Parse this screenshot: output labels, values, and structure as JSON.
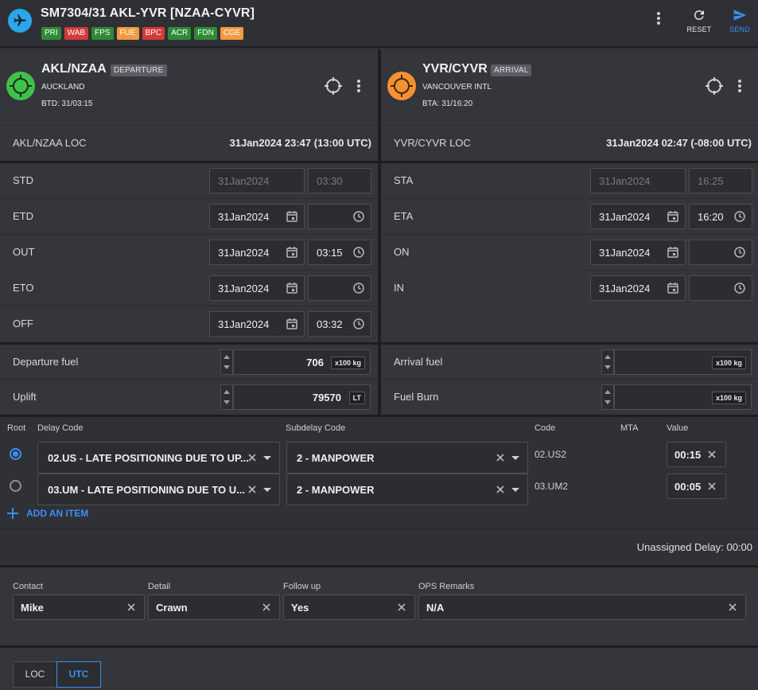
{
  "header": {
    "title": "SM7304/31 AKL-YVR [NZAA-CYVR]",
    "badges": [
      {
        "label": "PRI",
        "color": "#2f8a35"
      },
      {
        "label": "WAB",
        "color": "#d33a3a"
      },
      {
        "label": "FPS",
        "color": "#2f8a35"
      },
      {
        "label": "FUE",
        "color": "#f29a3f"
      },
      {
        "label": "BPC",
        "color": "#d33a3a"
      },
      {
        "label": "ACR",
        "color": "#2f8a35"
      },
      {
        "label": "FDN",
        "color": "#2f8a35"
      },
      {
        "label": "CGE",
        "color": "#f29a3f"
      }
    ],
    "reset_label": "RESET",
    "send_label": "SEND",
    "accent_color": "#3b8ef3"
  },
  "departure": {
    "code": "AKL/NZAA",
    "tag": "DEPARTURE",
    "city": "AUCKLAND",
    "btd": "BTD: 31/03:15",
    "status_color": "#3fc24a",
    "loc_label": "AKL/NZAA LOC",
    "loc_value": "31Jan2024 23:47 (13:00 UTC)",
    "times": [
      {
        "label": "STD",
        "date": "31Jan2024",
        "time": "03:30",
        "disabled": true
      },
      {
        "label": "ETD",
        "date": "31Jan2024",
        "time": ""
      },
      {
        "label": "OUT",
        "date": "31Jan2024",
        "time": "03:15"
      },
      {
        "label": "ETO",
        "date": "31Jan2024",
        "time": ""
      },
      {
        "label": "OFF",
        "date": "31Jan2024",
        "time": "03:32"
      }
    ],
    "fuel": [
      {
        "label": "Departure fuel",
        "value": "706",
        "unit": "x100 kg"
      },
      {
        "label": "Uplift",
        "value": "79570",
        "unit": "LT"
      }
    ]
  },
  "arrival": {
    "code": "YVR/CYVR",
    "tag": "ARRIVAL",
    "city": "VANCOUVER INTL",
    "bta": "BTA: 31/16:20",
    "status_color": "#f5922f",
    "loc_label": "YVR/CYVR LOC",
    "loc_value": "31Jan2024 02:47 (-08:00 UTC)",
    "times": [
      {
        "label": "STA",
        "date": "31Jan2024",
        "time": "16:25",
        "disabled": true
      },
      {
        "label": "ETA",
        "date": "31Jan2024",
        "time": "16:20"
      },
      {
        "label": "ON",
        "date": "31Jan2024",
        "time": ""
      },
      {
        "label": "IN",
        "date": "31Jan2024",
        "time": ""
      }
    ],
    "fuel": [
      {
        "label": "Arrival fuel",
        "value": "",
        "unit": "x100 kg"
      },
      {
        "label": "Fuel Burn",
        "value": "",
        "unit": "x100 kg"
      }
    ]
  },
  "delays": {
    "headers": {
      "root": "Root",
      "delay_code": "Delay Code",
      "subdelay_code": "Subdelay Code",
      "code": "Code",
      "mta": "MTA",
      "value": "Value"
    },
    "rows": [
      {
        "root": true,
        "delay": "02.US - LATE POSITIONING DUE TO UP...",
        "subdelay": "2 - MANPOWER",
        "code": "02.US2",
        "value": "00:15"
      },
      {
        "root": false,
        "delay": "03.UM - LATE POSITIONING DUE TO U...",
        "subdelay": "2 - MANPOWER",
        "code": "03.UM2",
        "value": "00:05"
      }
    ],
    "add_label": "ADD AN ITEM",
    "unassigned": "Unassigned Delay: 00:00"
  },
  "contact": {
    "contact_label": "Contact",
    "contact_value": "Mike",
    "detail_label": "Detail",
    "detail_value": "Crawn",
    "followup_label": "Follow up",
    "followup_value": "Yes",
    "remarks_label": "OPS Remarks",
    "remarks_value": "N/A"
  },
  "timezone": {
    "loc_label": "LOC",
    "utc_label": "UTC",
    "selected": "UTC"
  },
  "icons": [
    "airplane-icon",
    "more-vert-icon",
    "refresh-icon",
    "send-icon",
    "target-icon",
    "calendar-icon",
    "clock-icon",
    "close-icon",
    "plus-icon",
    "caret-down-icon",
    "radio-icon"
  ]
}
